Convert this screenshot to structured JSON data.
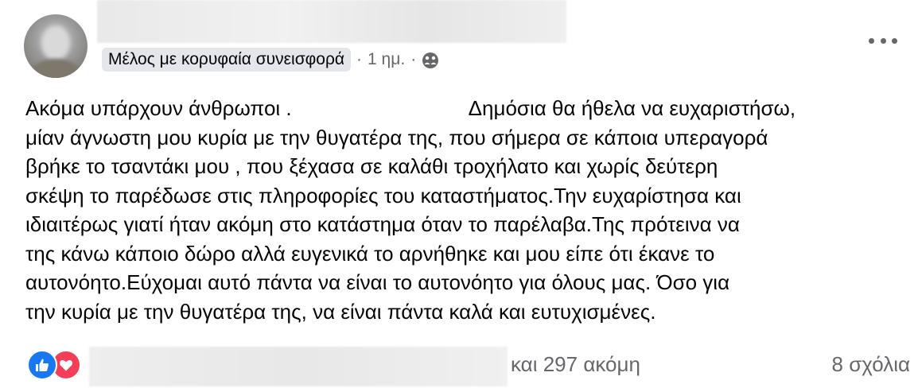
{
  "post": {
    "badge": "Μέλος με κορυφαία συνεισφορά",
    "time": "1 ημ.",
    "separator": "·",
    "privacy_icon": "group-icon",
    "lines": [
      "Ακόμα υπάρχουν άνθρωποι .",
      "Δημόσια θα ήθελα να ευχαριστήσω,",
      "μίαν άγνωστη μου κυρία με την θυγατέρα της, που σήμερα σε κάποια υπεραγορά",
      "βρήκε το τσαντάκι μου , που ξέχασα σε καλάθι τροχήλατο και χωρίς δεύτερη",
      "σκέψη το παρέδωσε στις πληροφορίες του καταστήματος.Την ευχαρίστησα και",
      "ιδιαιτέρως γιατί ήταν ακόμη στο κατάστημα όταν το παρέλαβα.Της πρότεινα να",
      "της κάνω κάποιο δώρο αλλά ευγενικά το αρνήθηκε και μου είπε ότι έκανε το",
      "αυτονόητο.Εύχομαι αυτό πάντα να είναι το αυτονόητο για όλους μας. Όσο  για",
      "την κυρία με την θυγατέρα της, να είναι πάντα καλά και ευτυχισμένες."
    ]
  },
  "footer": {
    "reaction_icons": [
      "like-icon",
      "love-icon"
    ],
    "and_more": "και 297 ακόμη",
    "comments": "8 σχόλια"
  },
  "colors": {
    "like": "#1877f2",
    "love": "#f33e58",
    "secondary_text": "#65676b",
    "badge_bg": "#e4e6eb"
  }
}
